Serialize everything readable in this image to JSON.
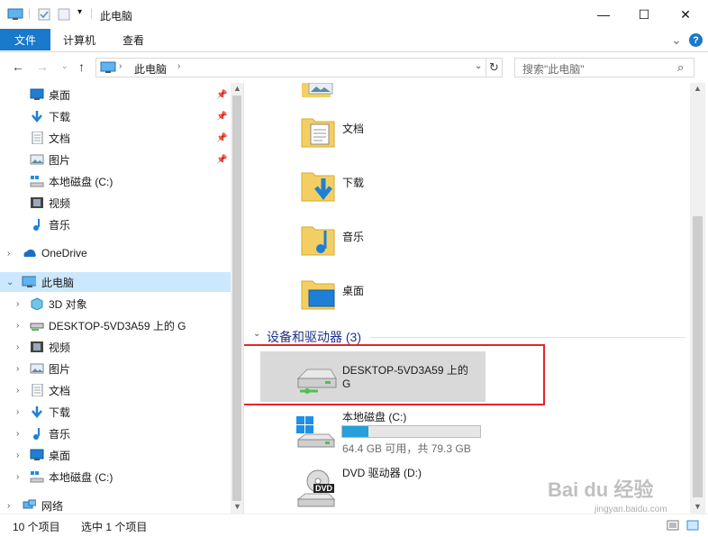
{
  "window": {
    "title": "此电脑",
    "minimize": "—",
    "maximize": "☐",
    "close": "✕"
  },
  "ribbon": {
    "file": "文件",
    "computer": "计算机",
    "view": "查看",
    "expand": "⌄",
    "help": "?"
  },
  "address": {
    "path": "此电脑",
    "search_placeholder": "搜索\"此电脑\""
  },
  "nav": {
    "quick": [
      {
        "label": "桌面",
        "icon": "desktop-icon"
      },
      {
        "label": "下载",
        "icon": "download-icon"
      },
      {
        "label": "文档",
        "icon": "document-icon"
      },
      {
        "label": "图片",
        "icon": "picture-icon"
      },
      {
        "label": "本地磁盘 (C:)",
        "icon": "local-disk-icon"
      },
      {
        "label": "视频",
        "icon": "video-icon"
      },
      {
        "label": "音乐",
        "icon": "music-icon"
      }
    ],
    "onedrive": "OneDrive",
    "thispc": "此电脑",
    "pc_children": [
      {
        "label": "3D 对象",
        "icon": "3d-objects-icon"
      },
      {
        "label": "DESKTOP-5VD3A59 上的 G",
        "icon": "network-drive-icon"
      },
      {
        "label": "视频",
        "icon": "video-icon"
      },
      {
        "label": "图片",
        "icon": "picture-icon"
      },
      {
        "label": "文档",
        "icon": "document-icon"
      },
      {
        "label": "下载",
        "icon": "download-icon"
      },
      {
        "label": "音乐",
        "icon": "music-icon"
      },
      {
        "label": "桌面",
        "icon": "desktop-icon"
      },
      {
        "label": "本地磁盘 (C:)",
        "icon": "local-disk-icon"
      }
    ],
    "network": "网络"
  },
  "content": {
    "folders": [
      {
        "label": "文档",
        "icon": "documents-folder-icon"
      },
      {
        "label": "下载",
        "icon": "downloads-folder-icon"
      },
      {
        "label": "音乐",
        "icon": "music-folder-icon"
      },
      {
        "label": "桌面",
        "icon": "desktop-folder-icon"
      }
    ],
    "devices_header": "设备和驱动器 (3)",
    "drives": [
      {
        "name_line1": "DESKTOP-5VD3A59 上的",
        "name_line2": "G",
        "icon": "network-drive-icon"
      },
      {
        "name": "本地磁盘 (C:)",
        "space": "64.4 GB 可用，共 79.3 GB",
        "used_fraction": 0.19,
        "icon": "windows-drive-icon"
      },
      {
        "name": "DVD 驱动器 (D:)",
        "icon": "dvd-drive-icon",
        "badge": "DVD"
      }
    ]
  },
  "status": {
    "count": "10 个项目",
    "selected": "选中 1 个项目"
  },
  "watermark": {
    "text": "Bai du 经验",
    "url": "jingyan.baidu.com"
  },
  "colors": {
    "accent": "#1979ca",
    "selection": "#cce8ff",
    "highlight_box": "#e0262b",
    "disk_bar": "#26a0da"
  }
}
